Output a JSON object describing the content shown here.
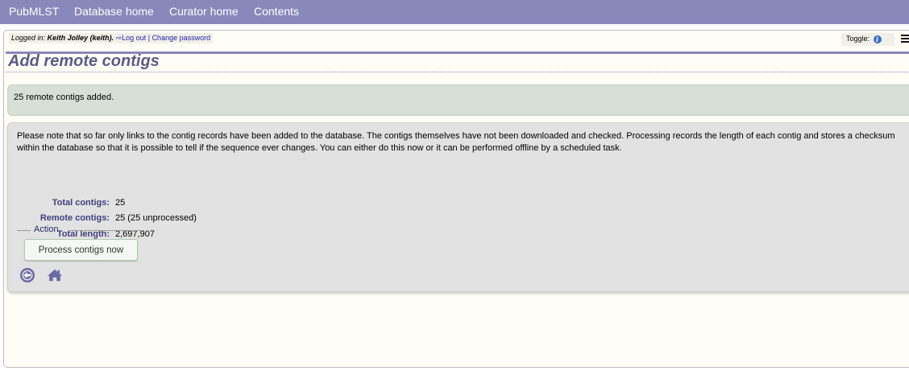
{
  "menubar": {
    "items": [
      "PubMLST",
      "Database home",
      "Curator home",
      "Contents"
    ]
  },
  "login": {
    "logged_in_label": "Logged in:",
    "user": "Keith Jolley (keith).",
    "logout_label": "Log out",
    "separator": "|",
    "change_password_label": "Change password"
  },
  "toggle": {
    "label": "Toggle:",
    "icon": "info-circle-icon"
  },
  "menu_icon": "hamburger-icon",
  "page": {
    "title": "Add remote contigs"
  },
  "success_message": "25 remote contigs added.",
  "note": "Please note that so far only links to the contig records have been added to the database. The contigs themselves have not been downloaded and checked. Processing records the length of each contig and stores a checksum within the database so that it is possible to tell if the sequence ever changes. You can either do this now or it can be performed offline by a scheduled task.",
  "stats": [
    {
      "label": "Total contigs:",
      "value": "25"
    },
    {
      "label": "Remote contigs:",
      "value": "25 (25 unprocessed)"
    },
    {
      "label": "Total length:",
      "value": "2,697,907"
    }
  ],
  "action": {
    "legend": "Action",
    "button_label": "Process contigs now"
  },
  "nav_icons": [
    "back-icon",
    "home-icon"
  ],
  "colors": {
    "menubar": "#8888bb",
    "title": "#5a5a8a",
    "success_bg": "#d6e0d6",
    "content_bg": "#e2e2e2",
    "label": "#404080",
    "icon": "#6a6aa8"
  }
}
